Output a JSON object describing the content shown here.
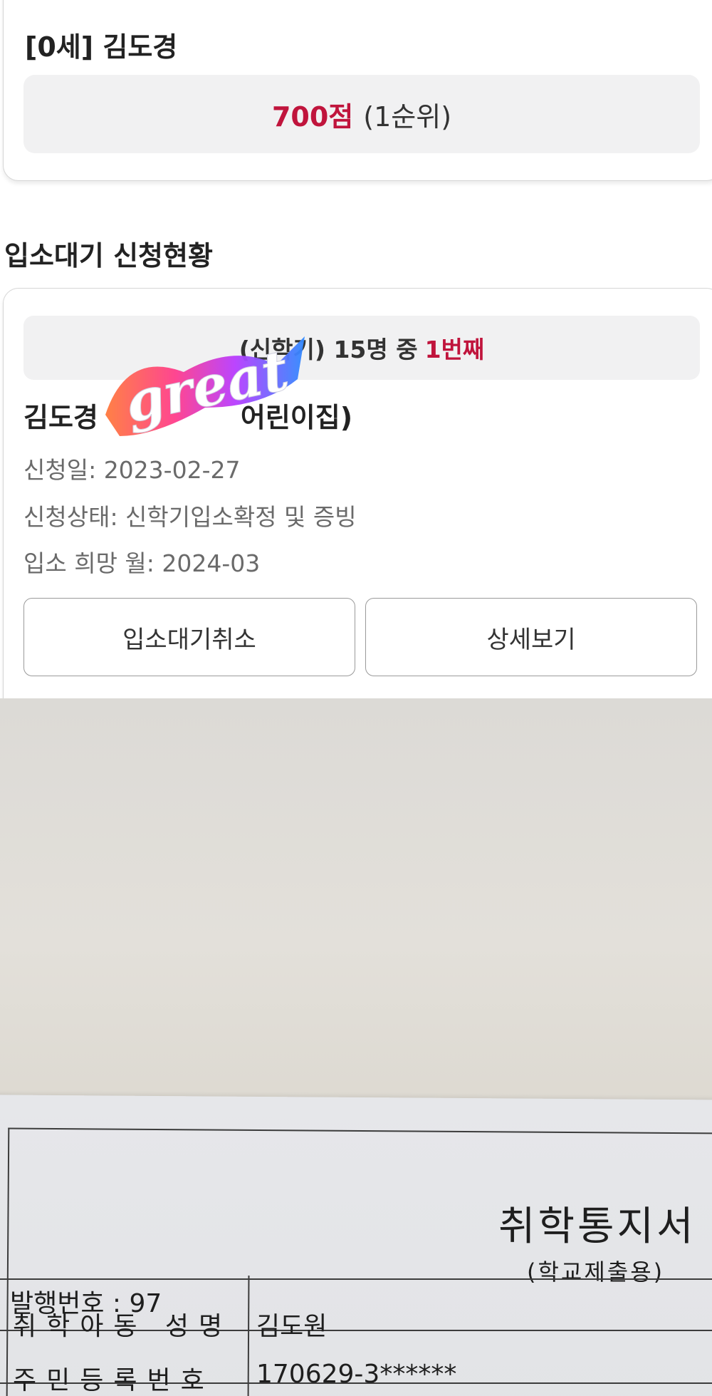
{
  "score_card": {
    "child_title": "[0세] 김도경",
    "score": "700점",
    "rank": "(1순위)"
  },
  "waitlist": {
    "section_title": "입소대기 신청현황",
    "rank_prefix": "(신학기) 15명 중",
    "rank_highlight": "1번째",
    "applicant": "김도경",
    "facility_visible": "어린이집)",
    "apply_date": "신청일: 2023-02-27",
    "status": "신청상태: 신학기입소확정 및 증빙",
    "desired_month": "입소 희망 월: 2024-03",
    "cancel_button": "입소대기취소",
    "detail_button": "상세보기"
  },
  "sticker": {
    "text": "great",
    "icon": "great-sticker-icon"
  },
  "document": {
    "title": "취학통지서",
    "subtitle": "(학교제출용)",
    "issue_number": "발행번호 : 97",
    "rows": [
      {
        "label": "취학아동 성명",
        "value": "김도원"
      },
      {
        "label": "주민등록번호",
        "value": "170629-3******"
      }
    ]
  },
  "colors": {
    "accent": "#c0143c",
    "box_bg": "#f1f1f2",
    "muted_text": "#6a6a6a"
  }
}
